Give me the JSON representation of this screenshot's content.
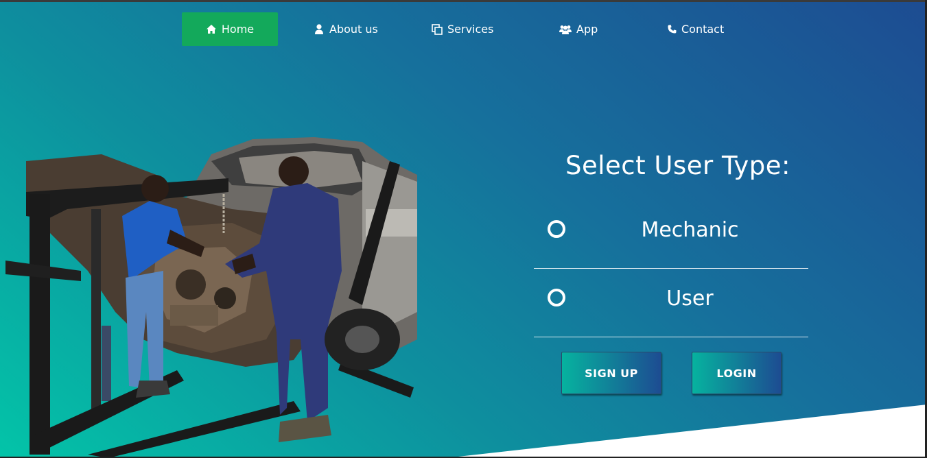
{
  "nav": {
    "items": [
      {
        "label": "Home",
        "icon": "home-icon",
        "active": true
      },
      {
        "label": "About us",
        "icon": "user-icon",
        "active": false
      },
      {
        "label": "Services",
        "icon": "copy-icon",
        "active": false
      },
      {
        "label": "App",
        "icon": "users-icon",
        "active": false
      },
      {
        "label": "Contact",
        "icon": "phone-icon",
        "active": false
      }
    ],
    "active_color": "#13a95b"
  },
  "hero": {
    "image": "mechanics-repairing-car-engine-photo",
    "gradient_start": "#03c4a8",
    "gradient_end": "#1d4c92"
  },
  "user_type": {
    "title": "Select User Type:",
    "options": [
      {
        "label": "Mechanic",
        "selected": false
      },
      {
        "label": "User",
        "selected": false
      }
    ]
  },
  "actions": {
    "signup_label": "SIGN UP",
    "login_label": "LOGIN"
  }
}
